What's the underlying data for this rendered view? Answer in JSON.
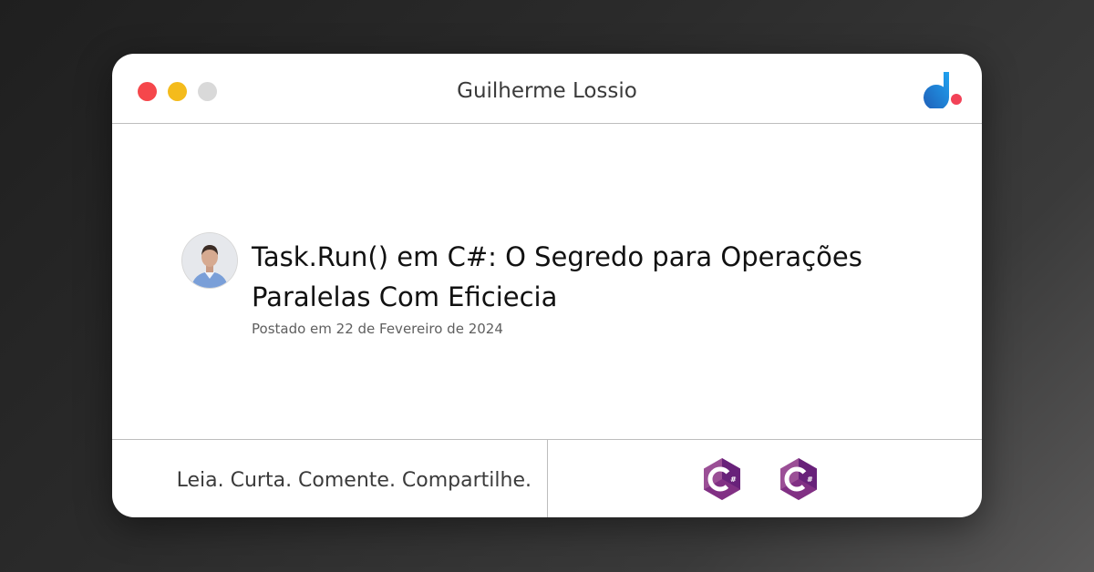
{
  "window": {
    "title": "Guilherme Lossio",
    "controls": [
      {
        "name": "close",
        "color": "#f5474b"
      },
      {
        "name": "minimize",
        "color": "#f4bb1c"
      },
      {
        "name": "maximize",
        "color": "#d9d9d9"
      }
    ],
    "logo_colors": [
      "#1f5fb8",
      "#1fa2f0",
      "#f24257"
    ]
  },
  "post": {
    "title": "Task.Run() em C#: O Segredo para Operações Paralelas Com Eficiecia",
    "date": "Postado em 22 de Fevereiro de 2024",
    "avatar": "author-photo"
  },
  "footer": {
    "tagline": "Leia. Curta. Comente. Compartilhe.",
    "tech_icons": [
      {
        "icon": "csharp-icon",
        "color": "#68217a"
      },
      {
        "icon": "csharp-icon",
        "color": "#68217a"
      }
    ]
  }
}
